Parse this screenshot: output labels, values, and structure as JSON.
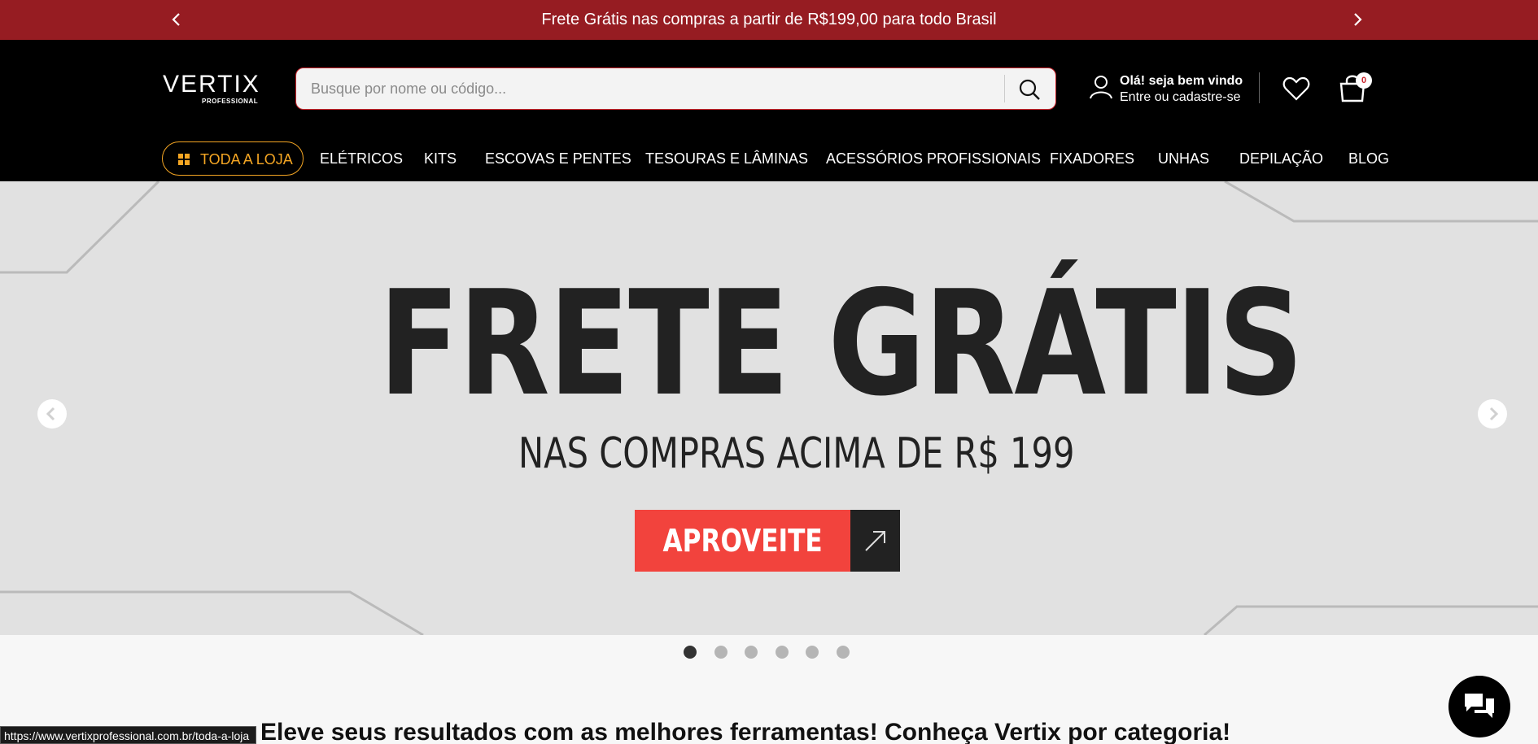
{
  "announcement": {
    "text": "Frete Grátis nas compras a partir de R$199,00 para todo Brasil",
    "prev_icon": "chevron-left-icon",
    "next_icon": "chevron-right-icon"
  },
  "header": {
    "logo_text": "VERTIX",
    "logo_sub": "PROFESSIONAL",
    "search": {
      "placeholder": "Busque por nome ou código...",
      "value": "",
      "icon": "search-icon"
    },
    "account": {
      "greeting": "Olá! seja bem vindo",
      "action": "Entre ou cadastre-se",
      "icon": "user-icon"
    },
    "wishlist_icon": "heart-icon",
    "cart": {
      "icon": "shopping-bag-icon",
      "count": "0"
    }
  },
  "nav": {
    "all_store": "TODA A LOJA",
    "items": [
      "ELÉTRICOS",
      "KITS",
      "ESCOVAS E PENTES",
      "TESOURAS E LÂMINAS",
      "ACESSÓRIOS PROFISSIONAIS",
      "FIXADORES",
      "UNHAS",
      "DEPILAÇÃO",
      "BLOG"
    ]
  },
  "hero": {
    "headline": "FRETE GRÁTIS",
    "subline": "NAS COMPRAS ACIMA DE R$ 199",
    "cta": "APROVEITE",
    "cta_icon": "arrow-up-right-icon",
    "slide_count": 6,
    "active_slide": 1
  },
  "section": {
    "title": "Eleve seus resultados com as melhores ferramentas! Conheça Vertix por categoria!"
  },
  "status_url": "https://www.vertixprofessional.com.br/toda-a-loja",
  "colors": {
    "announcement_bg": "#961c22",
    "header_bg": "#000000",
    "accent_orange": "#f5a623",
    "cta_red": "#f2433d",
    "search_border": "#c9232b"
  },
  "chat_icon": "chat-bubbles-icon"
}
